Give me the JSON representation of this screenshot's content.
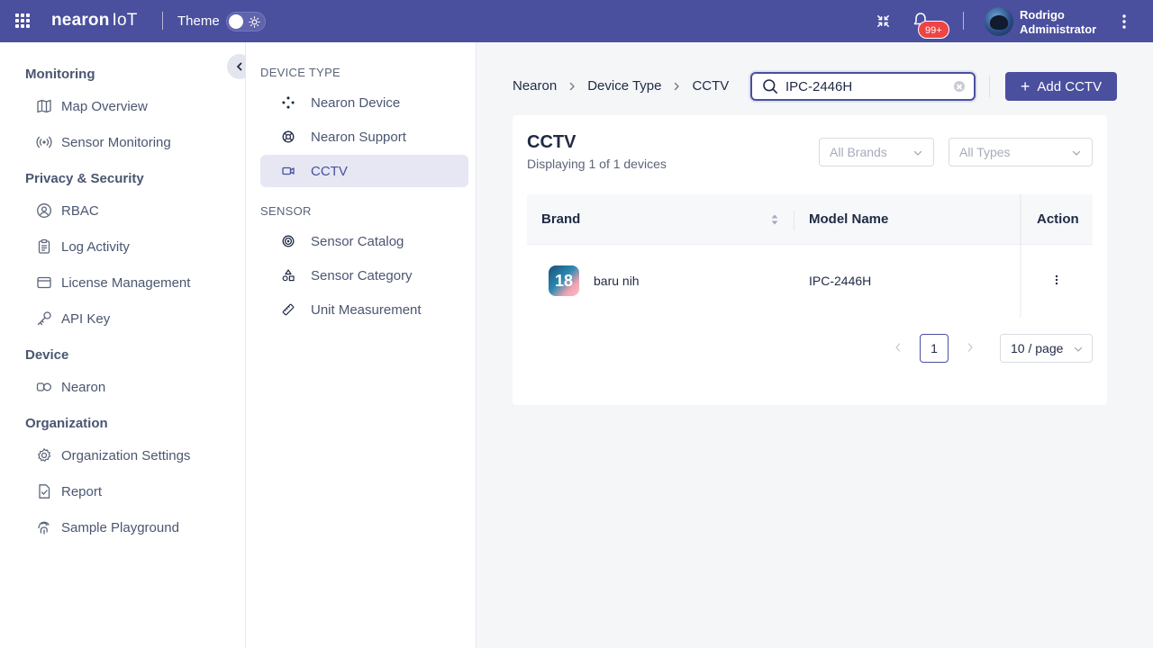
{
  "header": {
    "logo_main": "nearon",
    "logo_suffix": "IoT",
    "theme_label": "Theme",
    "notification_badge": "99+",
    "user_name": "Rodrigo",
    "user_role": "Administrator",
    "accent_color": "#4a4f9e"
  },
  "sidebar": {
    "sections": [
      {
        "title": "Monitoring",
        "items": [
          {
            "label": "Map Overview",
            "icon": "map-icon"
          },
          {
            "label": "Sensor Monitoring",
            "icon": "broadcast-icon"
          }
        ]
      },
      {
        "title": "Privacy & Security",
        "items": [
          {
            "label": "RBAC",
            "icon": "user-circle-icon"
          },
          {
            "label": "Log Activity",
            "icon": "clipboard-icon"
          },
          {
            "label": "License Management",
            "icon": "card-icon"
          },
          {
            "label": "API Key",
            "icon": "key-icon"
          }
        ]
      },
      {
        "title": "Device",
        "items": [
          {
            "label": "Nearon",
            "icon": "nearon-device-icon"
          }
        ]
      },
      {
        "title": "Organization",
        "items": [
          {
            "label": "Organization Settings",
            "icon": "gear-icon"
          },
          {
            "label": "Report",
            "icon": "file-check-icon"
          },
          {
            "label": "Sample Playground",
            "icon": "fingerprint-icon"
          }
        ]
      }
    ]
  },
  "subnav": {
    "device_type_title": "DEVICE TYPE",
    "device_types": [
      {
        "label": "Nearon Device",
        "icon": "diamond-dots-icon"
      },
      {
        "label": "Nearon Support",
        "icon": "lifebuoy-icon"
      },
      {
        "label": "CCTV",
        "icon": "video-camera-icon",
        "active": true
      }
    ],
    "sensor_title": "SENSOR",
    "sensor_items": [
      {
        "label": "Sensor Catalog",
        "icon": "target-icon"
      },
      {
        "label": "Sensor Category",
        "icon": "shapes-icon"
      },
      {
        "label": "Unit Measurement",
        "icon": "ruler-icon"
      }
    ]
  },
  "breadcrumb": [
    "Nearon",
    "Device Type",
    "CCTV"
  ],
  "search": {
    "value": "IPC-2446H",
    "placeholder": "Search"
  },
  "add_button": {
    "label": "Add CCTV"
  },
  "card": {
    "title": "CCTV",
    "subtitle": "Displaying 1 of 1 devices",
    "brand_filter": "All Brands",
    "type_filter": "All Types"
  },
  "table": {
    "columns": [
      "Brand",
      "Model Name",
      "Action"
    ],
    "rows": [
      {
        "brand": "baru nih",
        "brand_logo_text": "18",
        "model": "IPC-2446H"
      }
    ]
  },
  "pagination": {
    "current_page": "1",
    "page_size": "10 / page"
  }
}
